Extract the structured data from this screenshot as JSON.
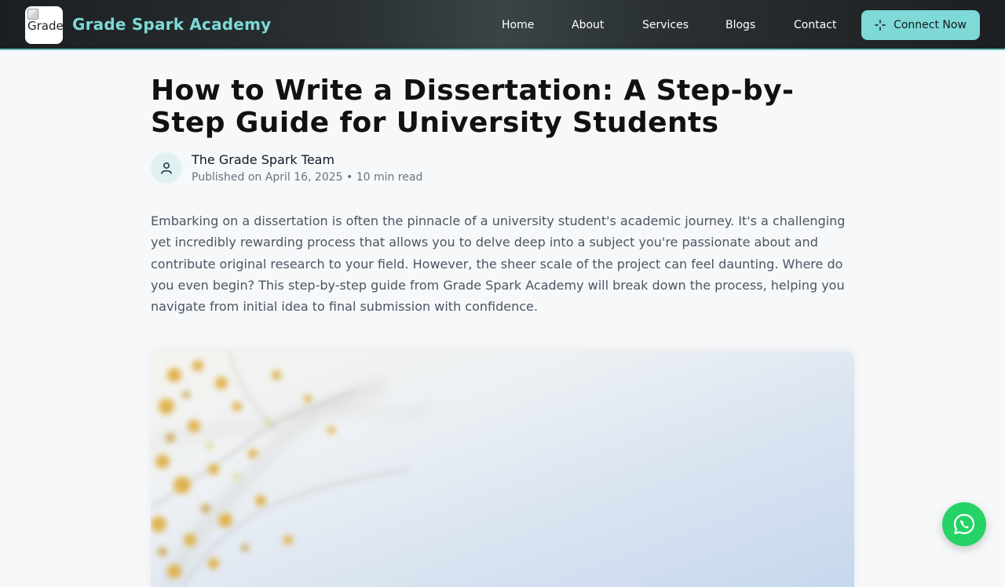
{
  "header": {
    "logo_alt": "Grade",
    "brand": "Grade Spark Academy",
    "nav": [
      {
        "label": "Home"
      },
      {
        "label": "About"
      },
      {
        "label": "Services"
      },
      {
        "label": "Blogs"
      },
      {
        "label": "Contact"
      }
    ],
    "cta_label": "Connect Now",
    "cta_icon": "sparkle-icon"
  },
  "article": {
    "title": "How to Write a Dissertation: A Step-by-Step Guide for University Students",
    "author": "The Grade Spark Team",
    "meta": "Published on April 16, 2025 • 10 min read",
    "intro": "Embarking on a dissertation is often the pinnacle of a university student's academic journey. It's a challenging yet incredibly rewarding process that allows you to delve deep into a subject you're passionate about and contribute original research to your field. However, the sheer scale of the project can feel daunting. Where do you even begin? This step-by-step guide from Grade Spark Academy will break down the process, helping you navigate from initial idea to final submission with confidence."
  },
  "floating": {
    "whatsapp_icon": "whatsapp-icon"
  },
  "colors": {
    "accent": "#7ed9d7",
    "whatsapp": "#25d366",
    "header_bg": "#2a3033"
  }
}
